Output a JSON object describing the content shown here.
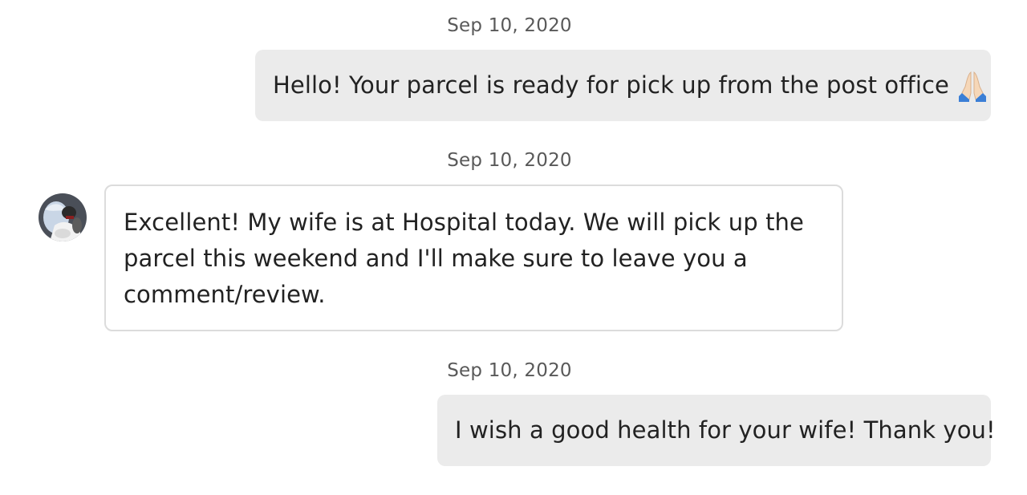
{
  "conversation": {
    "messages": [
      {
        "timestamp": "Sep 10, 2020",
        "direction": "outgoing",
        "text": "Hello! Your parcel is ready for pick up from the post office",
        "trailing_icon": "folded-hands-icon"
      },
      {
        "timestamp": "Sep 10, 2020",
        "direction": "incoming",
        "text": "Excellent! My wife is at Hospital today. We will pick up the parcel this weekend and I'll make sure to leave you a comment/review.",
        "avatar_icon": "user-avatar"
      },
      {
        "timestamp": "Sep 10, 2020",
        "direction": "outgoing",
        "text": "I wish a good health for your wife! Thank you!"
      }
    ]
  },
  "colors": {
    "outgoing_bubble": "#ebebeb",
    "incoming_border": "#dcdcdc",
    "timestamp_text": "#595959",
    "message_text": "#222222"
  }
}
